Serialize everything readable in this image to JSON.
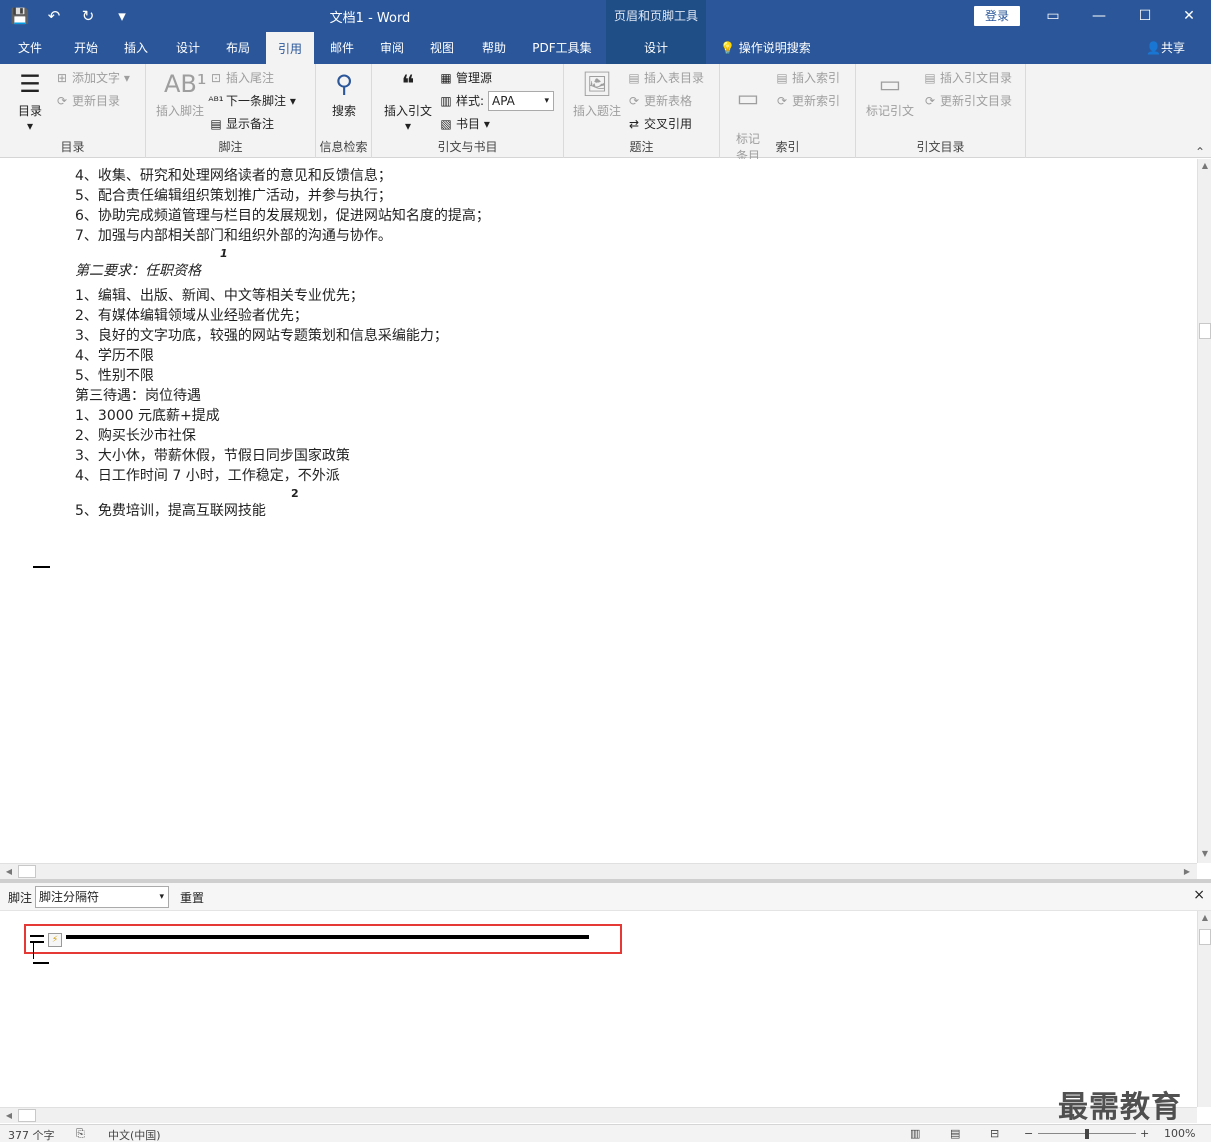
{
  "titlebar": {
    "title": "文档1  -  Word",
    "context_group": "页眉和页脚工具",
    "login": "登录"
  },
  "tabs": [
    "文件",
    "开始",
    "插入",
    "设计",
    "布局",
    "引用",
    "邮件",
    "审阅",
    "视图",
    "帮助",
    "PDF工具集",
    "设计"
  ],
  "tell_me": "操作说明搜索",
  "share": "共享",
  "ribbon": {
    "toc": {
      "big": "目录",
      "add_text": "添加文字",
      "update": "更新目录",
      "label": "目录"
    },
    "footnotes": {
      "insert_footnote": "插入脚注",
      "insert_endnote": "插入尾注",
      "next_footnote": "下一条脚注",
      "show_notes": "显示备注",
      "label": "脚注"
    },
    "research": {
      "search": "搜索",
      "label": "信息检索"
    },
    "citations": {
      "insert_citation": "插入引文",
      "manage_sources": "管理源",
      "style_label": "样式:",
      "style_value": "APA",
      "bibliography": "书目",
      "label": "引文与书目"
    },
    "captions": {
      "insert_caption": "插入题注",
      "insert_table_of_figures": "插入表目录",
      "update_table": "更新表格",
      "cross_ref": "交叉引用",
      "label": "题注"
    },
    "index": {
      "mark_entry": "标记\n条目",
      "insert_index": "插入索引",
      "update_index": "更新索引",
      "label": "索引"
    },
    "toa": {
      "mark_citation": "标记引文",
      "insert_toa": "插入引文目录",
      "update_toa": "更新引文目录",
      "label": "引文目录"
    }
  },
  "document": {
    "lines": [
      "4、收集、研究和处理网络读者的意见和反馈信息；",
      "5、配合责任编辑组织策划推广活动，并参与执行；",
      "6、协助完成频道管理与栏目的发展规划，促进网站知名度的提高；",
      "7、加强与内部相关部门和组织外部的沟通与协作。",
      "第二要求：任职资格",
      "1、编辑、出版、新闻、中文等相关专业优先；",
      "2、有媒体编辑领域从业经验者优先；",
      "3、良好的文字功底，较强的网站专题策划和信息采编能力；",
      "4、学历不限",
      "5、性别不限",
      "第三待遇：岗位待遇",
      "1、3000 元底薪+提成",
      "2、购买长沙市社保",
      "3、大小休，带薪休假，节假日同步国家政策",
      "4、日工作时间 7 小时，工作稳定，不外派",
      "5、免费培训，提高互联网技能"
    ],
    "footnote_ref_1": "1",
    "footnote_ref_2": "2"
  },
  "footnote_pane": {
    "label": "脚注",
    "select_value": "脚注分隔符",
    "reset": "重置",
    "close": "×"
  },
  "statusbar": {
    "words": "377 个字",
    "language": "中文(中国)",
    "zoom": "100%"
  },
  "watermark": "最需教育"
}
